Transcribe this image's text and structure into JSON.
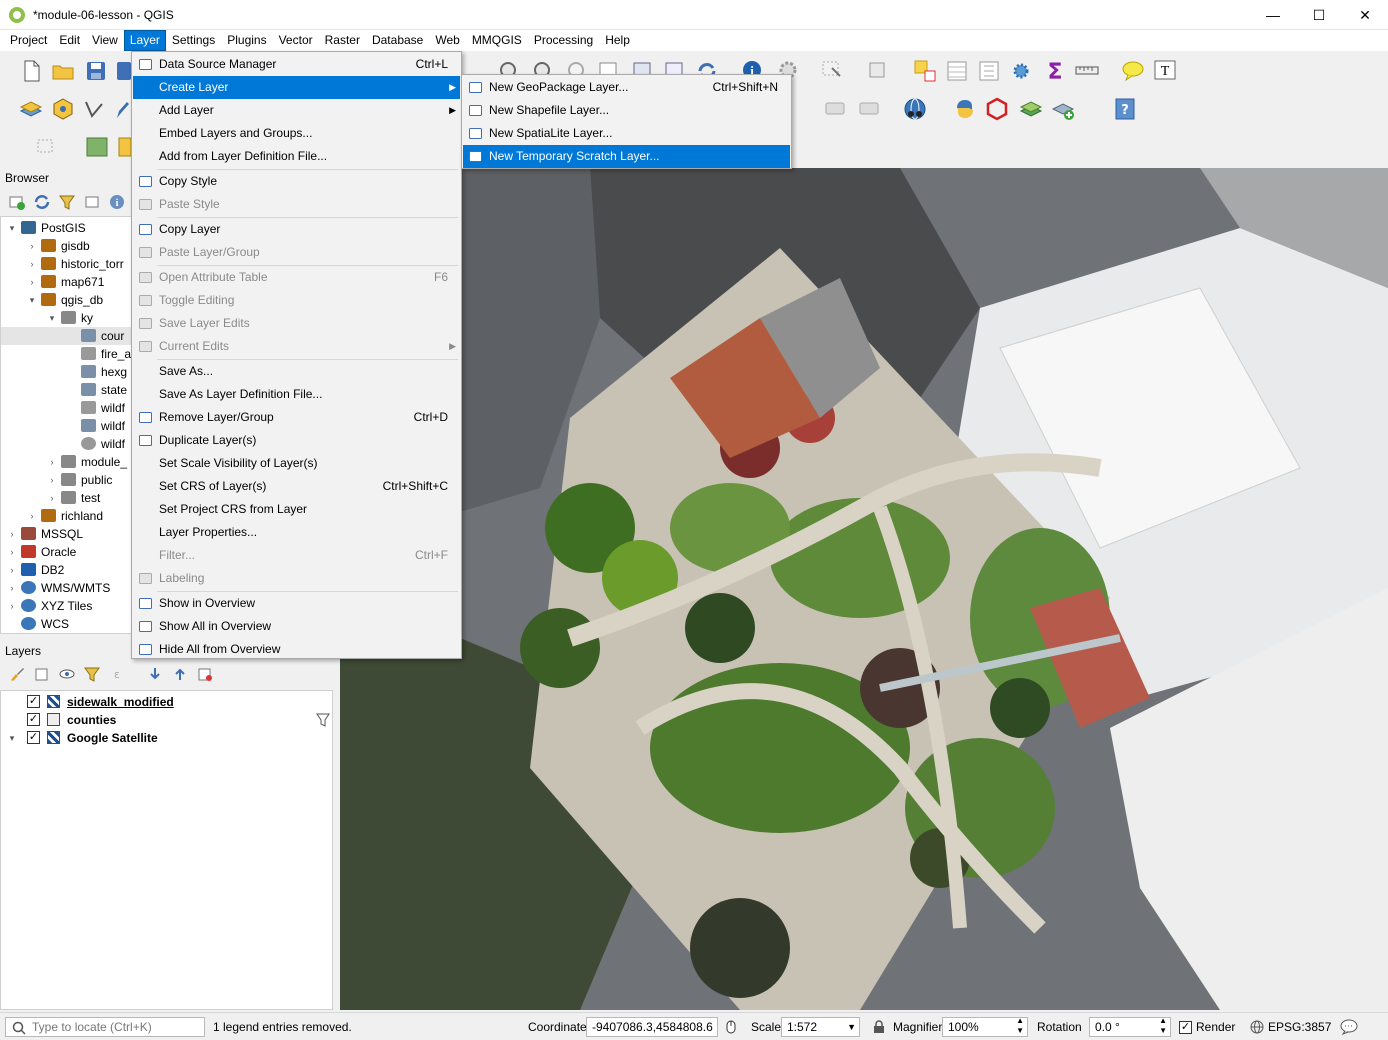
{
  "window": {
    "title": "*module-06-lesson - QGIS",
    "minimize": "—",
    "maximize": "☐",
    "close": "✕"
  },
  "menubar": [
    "Project",
    "Edit",
    "View",
    "Layer",
    "Settings",
    "Plugins",
    "Vector",
    "Raster",
    "Database",
    "Web",
    "MMQGIS",
    "Processing",
    "Help"
  ],
  "browser": {
    "title": "Browser",
    "tree": [
      {
        "label": "PostGIS",
        "level": 0,
        "arrow": "▾",
        "icon": "postgis-icon"
      },
      {
        "label": "gisdb",
        "level": 1,
        "arrow": "›",
        "icon": "connection-icon"
      },
      {
        "label": "historic_torr",
        "level": 1,
        "arrow": "›",
        "icon": "connection-icon"
      },
      {
        "label": "map671",
        "level": 1,
        "arrow": "›",
        "icon": "connection-icon"
      },
      {
        "label": "qgis_db",
        "level": 1,
        "arrow": "▾",
        "icon": "connection-icon"
      },
      {
        "label": "ky",
        "level": 2,
        "arrow": "▾",
        "icon": "schema-icon"
      },
      {
        "label": "cour",
        "level": 3,
        "arrow": "",
        "icon": "polygon-icon"
      },
      {
        "label": "fire_a",
        "level": 3,
        "arrow": "",
        "icon": "table-icon"
      },
      {
        "label": "hexg",
        "level": 3,
        "arrow": "",
        "icon": "polygon-icon"
      },
      {
        "label": "state",
        "level": 3,
        "arrow": "",
        "icon": "polygon-icon"
      },
      {
        "label": "wildf",
        "level": 3,
        "arrow": "",
        "icon": "table-icon"
      },
      {
        "label": "wildf",
        "level": 3,
        "arrow": "",
        "icon": "polygon-icon"
      },
      {
        "label": "wildf",
        "level": 3,
        "arrow": "",
        "icon": "point-icon"
      },
      {
        "label": "module_",
        "level": 2,
        "arrow": "›",
        "icon": "schema-icon"
      },
      {
        "label": "public",
        "level": 2,
        "arrow": "›",
        "icon": "schema-icon"
      },
      {
        "label": "test",
        "level": 2,
        "arrow": "›",
        "icon": "schema-icon"
      },
      {
        "label": "richland",
        "level": 1,
        "arrow": "›",
        "icon": "connection-icon"
      },
      {
        "label": "MSSQL",
        "level": 0,
        "arrow": "›",
        "icon": "mssql-icon"
      },
      {
        "label": "Oracle",
        "level": 0,
        "arrow": "›",
        "icon": "oracle-icon"
      },
      {
        "label": "DB2",
        "level": 0,
        "arrow": "›",
        "icon": "db2-icon"
      },
      {
        "label": "WMS/WMTS",
        "level": 0,
        "arrow": "›",
        "icon": "globe-icon"
      },
      {
        "label": "XYZ Tiles",
        "level": 0,
        "arrow": "›",
        "icon": "globe-icon"
      },
      {
        "label": "WCS",
        "level": 0,
        "arrow": "",
        "icon": "globe-icon"
      }
    ]
  },
  "layers": {
    "title": "Layers",
    "items": [
      {
        "label": "sidewalk_modified",
        "checked": "✓",
        "underline": true
      },
      {
        "label": "counties",
        "checked": "✓",
        "underline": false
      },
      {
        "label": "Google Satellite",
        "checked": "✓",
        "underline": false
      }
    ]
  },
  "layer_menu": {
    "items": [
      {
        "label": "Data Source Manager",
        "shortcut": "Ctrl+L",
        "state": "normal",
        "icon": "data-source-icon"
      },
      {
        "label": "Create Layer",
        "shortcut": "",
        "state": "highlight",
        "submenu": true
      },
      {
        "label": "Add Layer",
        "shortcut": "",
        "state": "normal",
        "submenu": true
      },
      {
        "label": "Embed Layers and Groups...",
        "shortcut": "",
        "state": "normal"
      },
      {
        "label": "Add from Layer Definition File...",
        "shortcut": "",
        "state": "normal"
      },
      {
        "sep": true
      },
      {
        "label": "Copy Style",
        "shortcut": "",
        "state": "normal",
        "icon": "copy-icon"
      },
      {
        "label": "Paste Style",
        "shortcut": "",
        "state": "disabled",
        "icon": "paste-icon"
      },
      {
        "sep": true
      },
      {
        "label": "Copy Layer",
        "shortcut": "",
        "state": "normal",
        "icon": "copy-icon"
      },
      {
        "label": "Paste Layer/Group",
        "shortcut": "",
        "state": "disabled",
        "icon": "paste-icon"
      },
      {
        "sep": true
      },
      {
        "label": "Open Attribute Table",
        "shortcut": "F6",
        "state": "disabled",
        "icon": "table-icon"
      },
      {
        "label": "Toggle Editing",
        "shortcut": "",
        "state": "disabled",
        "icon": "pencil-icon"
      },
      {
        "label": "Save Layer Edits",
        "shortcut": "",
        "state": "disabled",
        "icon": "save-icon"
      },
      {
        "label": "Current Edits",
        "shortcut": "",
        "state": "disabled",
        "icon": "edits-icon",
        "submenu": true
      },
      {
        "sep": true
      },
      {
        "label": "Save As...",
        "shortcut": "",
        "state": "normal"
      },
      {
        "label": "Save As Layer Definition File...",
        "shortcut": "",
        "state": "normal"
      },
      {
        "label": "Remove Layer/Group",
        "shortcut": "Ctrl+D",
        "state": "normal",
        "icon": "remove-layer-icon"
      },
      {
        "label": "Duplicate Layer(s)",
        "shortcut": "",
        "state": "normal",
        "icon": "duplicate-icon"
      },
      {
        "label": "Set Scale Visibility of Layer(s)",
        "shortcut": "",
        "state": "normal"
      },
      {
        "label": "Set CRS of Layer(s)",
        "shortcut": "Ctrl+Shift+C",
        "state": "normal"
      },
      {
        "label": "Set Project CRS from Layer",
        "shortcut": "",
        "state": "normal"
      },
      {
        "label": "Layer Properties...",
        "shortcut": "",
        "state": "normal"
      },
      {
        "label": "Filter...",
        "shortcut": "Ctrl+F",
        "state": "disabled"
      },
      {
        "label": "Labeling",
        "shortcut": "",
        "state": "disabled",
        "icon": "label-icon"
      },
      {
        "sep": true
      },
      {
        "label": "Show in Overview",
        "shortcut": "",
        "state": "normal",
        "icon": "overview-icon"
      },
      {
        "label": "Show All in Overview",
        "shortcut": "",
        "state": "normal",
        "icon": "overview-icon"
      },
      {
        "label": "Hide All from Overview",
        "shortcut": "",
        "state": "normal",
        "icon": "overview-icon"
      }
    ]
  },
  "create_layer_menu": {
    "items": [
      {
        "label": "New GeoPackage Layer...",
        "shortcut": "Ctrl+Shift+N",
        "state": "normal",
        "icon": "geopackage-icon"
      },
      {
        "label": "New Shapefile Layer...",
        "shortcut": "",
        "state": "normal",
        "icon": "shapefile-icon"
      },
      {
        "label": "New SpatiaLite Layer...",
        "shortcut": "",
        "state": "normal",
        "icon": "spatialite-icon"
      },
      {
        "label": "New Temporary Scratch Layer...",
        "shortcut": "",
        "state": "highlight",
        "icon": "scratch-layer-icon"
      }
    ]
  },
  "statusbar": {
    "locate_placeholder": "Type to locate (Ctrl+K)",
    "message": "1 legend entries removed.",
    "coordinate_label": "Coordinate",
    "coordinate_value": "-9407086.3,4584808.6",
    "scale_label": "Scale",
    "scale_value": "1:572",
    "magnifier_label": "Magnifier",
    "magnifier_value": "100%",
    "rotation_label": "Rotation",
    "rotation_value": "0.0 °",
    "render_label": "Render",
    "crs_label": "EPSG:3857"
  }
}
